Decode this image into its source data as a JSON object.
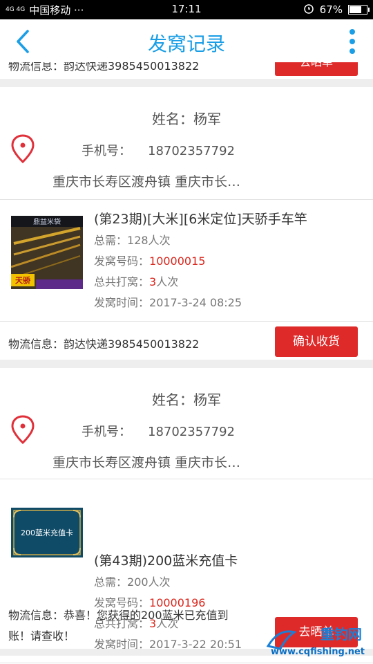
{
  "status_bar": {
    "network": "4G 4G",
    "carrier": "中国移动 ···",
    "time": "17:11",
    "battery": "67%"
  },
  "header": {
    "title": "发窝记录"
  },
  "peek": {
    "text": "物流信息：韵达快递3985450013822",
    "button": "去晒单"
  },
  "records": [
    {
      "name": "姓名：杨军",
      "phone_label": "手机号：",
      "phone": "18702357792",
      "address": "重庆市长寿区渡舟镇 重庆市长…",
      "product_title": "(第23期)[大米][6米定位]天骄手车竿",
      "thumb_text_top": "鼎益米袋",
      "thumb_text_bottom": "天骄",
      "total_label": "总需：",
      "total": "128人次",
      "code_label": "发窝号码：",
      "code": "10000015",
      "count_label": "总共打窝：",
      "count_num": "3",
      "count_unit": "人次",
      "time_label": "发窝时间：",
      "time": "2017-3-24 08:25",
      "logistics": "物流信息：韵达快递3985450013822",
      "button": "确认收货"
    },
    {
      "name": "姓名：杨军",
      "phone_label": "手机号：",
      "phone": "18702357792",
      "address": "重庆市长寿区渡舟镇 重庆市长…",
      "product_title": "(第43期)200蓝米充值卡",
      "thumb_text": "200蓝米充值卡",
      "total_label": "总需：",
      "total": "200人次",
      "code_label": "发窝号码：",
      "code": "10000196",
      "count_label": "总共打窝：",
      "count_num": "3",
      "count_unit": "人次",
      "time_label": "发窝时间：",
      "time": "2017-3-22 20:51",
      "logistics_line1": "物流信息：恭喜！您获得的200蓝米已充值到",
      "logistics_line2": "账！请查收！",
      "button": "去晒单"
    }
  ],
  "watermark": {
    "cn": "重钓网",
    "url": "www.cqfishing.net"
  },
  "colors": {
    "accent": "#1a9ee6",
    "button_red": "#df2a2a",
    "highlight_red": "#d9261c"
  }
}
